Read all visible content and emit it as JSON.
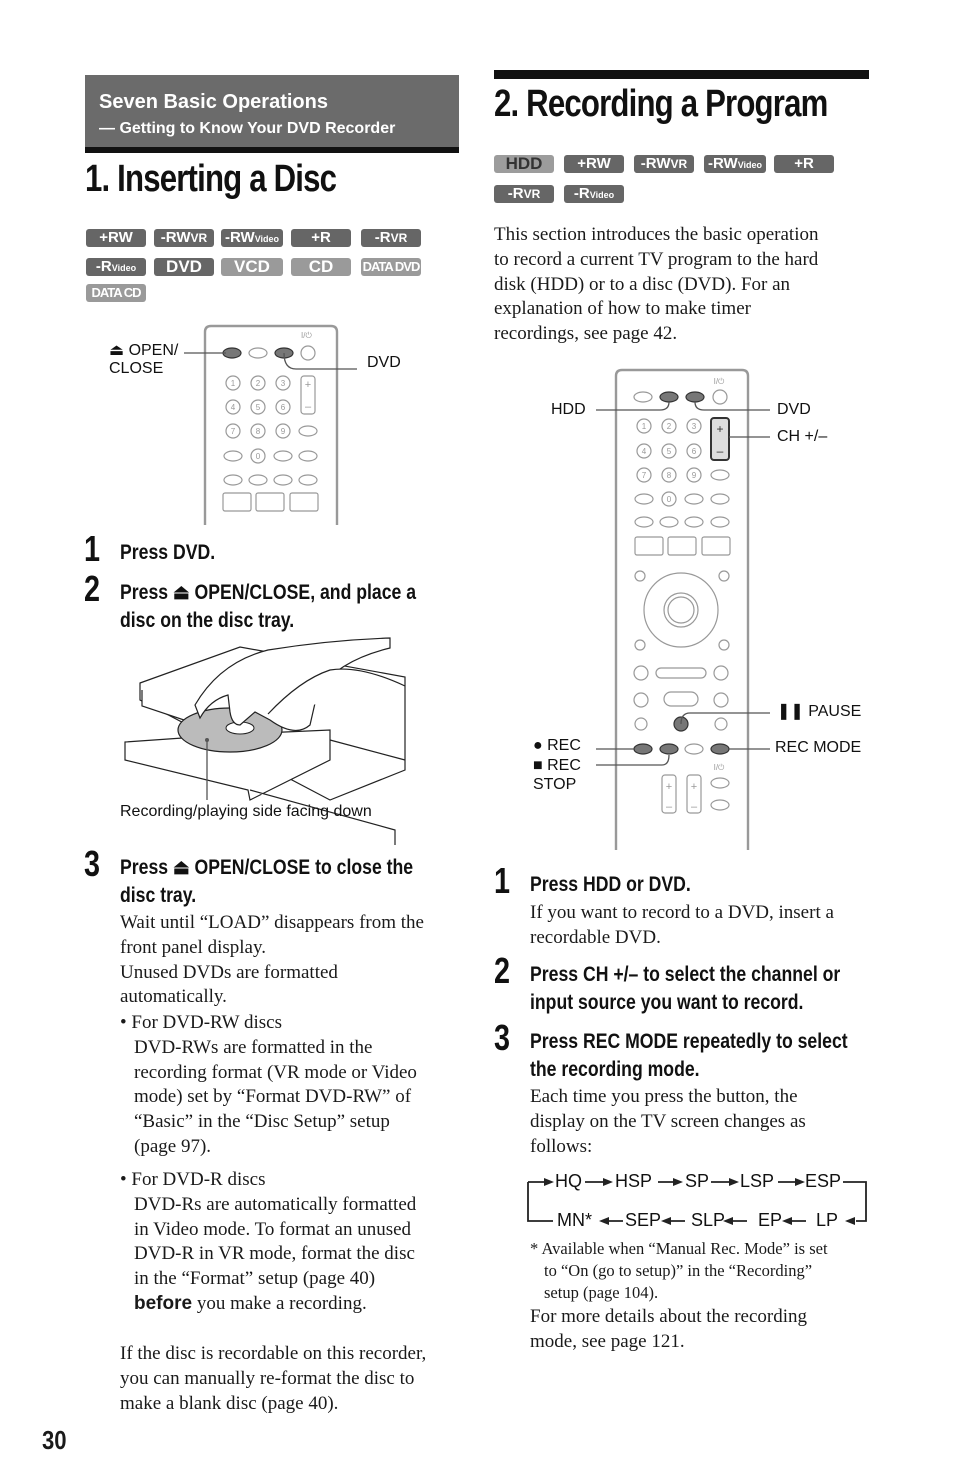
{
  "section_header": {
    "title": "Seven Basic Operations",
    "subtitle": "— Getting to Know Your DVD Recorder"
  },
  "left": {
    "heading": "1. Inserting a Disc",
    "badges": [
      {
        "main": "+RW",
        "sub": ""
      },
      {
        "main": "-RW",
        "sub": "VR"
      },
      {
        "main": "-RW",
        "sub": "Video"
      },
      {
        "main": "+R",
        "sub": ""
      },
      {
        "main": "-R",
        "sub": "VR"
      },
      {
        "main": "-R",
        "sub": "Video"
      },
      {
        "main": "DVD",
        "sub": ""
      },
      {
        "main": "VCD",
        "sub": ""
      },
      {
        "main": "CD",
        "sub": ""
      },
      {
        "main": "DATA DVD",
        "sub": ""
      },
      {
        "main": "DATA CD",
        "sub": ""
      }
    ],
    "remote_labels": {
      "open_close_line1": "⏏ OPEN/",
      "open_close_line2": "CLOSE",
      "dvd": "DVD",
      "power": "I/⏻"
    },
    "steps": [
      {
        "num": "1",
        "title": "Press DVD."
      },
      {
        "num": "2",
        "title_line1": "Press ⏏ OPEN/CLOSE, and place a",
        "title_line2": "disc on the disc tray."
      },
      {
        "num": "3",
        "title_line1": "Press ⏏ OPEN/CLOSE to close the",
        "title_line2": "disc tray."
      }
    ],
    "illustration_caption": "Recording/playing side facing down",
    "step3_body": [
      "Wait until “LOAD” disappears from the",
      "front panel display.",
      "Unused DVDs are formatted",
      "automatically."
    ],
    "bullet1": {
      "lead": "• For DVD-RW discs",
      "lines": [
        "DVD-RWs are formatted in the",
        "recording format (VR mode or Video",
        "mode) set by “Format DVD-RW” of",
        "“Basic” in the “Disc Setup” setup",
        "(page 97)."
      ]
    },
    "bullet2": {
      "lead": "• For DVD-R discs",
      "lines": [
        "DVD-Rs are automatically formatted",
        "in Video mode. To format an unused",
        "DVD-R in VR mode, format the disc",
        "in the “Format” setup (page 40)"
      ],
      "bold_word": "before",
      "last_line_rest": " you make a recording."
    },
    "closing": [
      "If the disc is recordable on this recorder,",
      "you can manually re-format the disc to",
      "make a blank disc (page 40)."
    ]
  },
  "right": {
    "heading": "2. Recording a Program",
    "badges": [
      {
        "main": "HDD",
        "sub": ""
      },
      {
        "main": "+RW",
        "sub": ""
      },
      {
        "main": "-RW",
        "sub": "VR"
      },
      {
        "main": "-RW",
        "sub": "Video"
      },
      {
        "main": "+R",
        "sub": ""
      },
      {
        "main": "-R",
        "sub": "VR"
      },
      {
        "main": "-R",
        "sub": "Video"
      }
    ],
    "intro": [
      "This section introduces the basic operation",
      "to record a current TV program to the hard",
      "disk (HDD) or to a disc (DVD). For an",
      "explanation of how to make timer",
      "recordings, see page 42."
    ],
    "remote_labels": {
      "hdd": "HDD",
      "dvd": "DVD",
      "ch": "CH +/–",
      "pause": "❚❚ PAUSE",
      "rec": "● REC",
      "rec_stop_line1": "■ REC",
      "rec_stop_line2": "STOP",
      "rec_mode": "REC MODE",
      "power": "I/⏻"
    },
    "steps": [
      {
        "num": "1",
        "title": "Press HDD or DVD.",
        "body": [
          "If you want to record to a DVD, insert a",
          "recordable DVD."
        ]
      },
      {
        "num": "2",
        "title_line1": "Press CH +/– to select the channel or",
        "title_line2": "input source you want to record."
      },
      {
        "num": "3",
        "title_line1": "Press REC MODE repeatedly to select",
        "title_line2": "the recording mode.",
        "body": [
          "Each time you press the button, the",
          "display on the TV screen changes as",
          "follows:"
        ]
      }
    ],
    "mode_cycle": {
      "top_row": [
        "HQ",
        "HSP",
        "SP",
        "LSP",
        "ESP"
      ],
      "bottom_row": [
        "MN*",
        "SEP",
        "SLP",
        "EP",
        "LP"
      ]
    },
    "footnote": [
      "* Available when “Manual Rec. Mode” is set",
      "to “On (go to setup)” in the “Recording”",
      "setup (page 104)."
    ],
    "more": [
      "For more details about the recording",
      "mode, see page 121."
    ]
  },
  "page_number": "30"
}
